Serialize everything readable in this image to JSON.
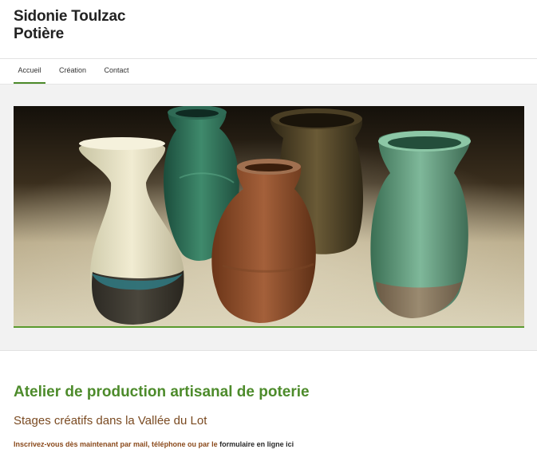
{
  "site": {
    "title_line1": "Sidonie Toulzac",
    "title_line2": "Potière"
  },
  "nav": {
    "items": [
      {
        "label": "Accueil",
        "active": true
      },
      {
        "label": "Création",
        "active": false
      },
      {
        "label": "Contact",
        "active": false
      }
    ]
  },
  "banner": {
    "image_subject": "pottery-vases-photo"
  },
  "content": {
    "heading": "Atelier de production artisanal de poterie",
    "subheading": "Stages créatifs dans la Vallée du Lot",
    "cta_text": "Inscrivez-vous dès maintenant par mail, téléphone ou par le ",
    "cta_link": "formulaire en ligne ici"
  },
  "colors": {
    "accent_green": "#4d8b2b",
    "subheading_brown": "#7a4a21",
    "cta_brown": "#8a4a1c"
  }
}
